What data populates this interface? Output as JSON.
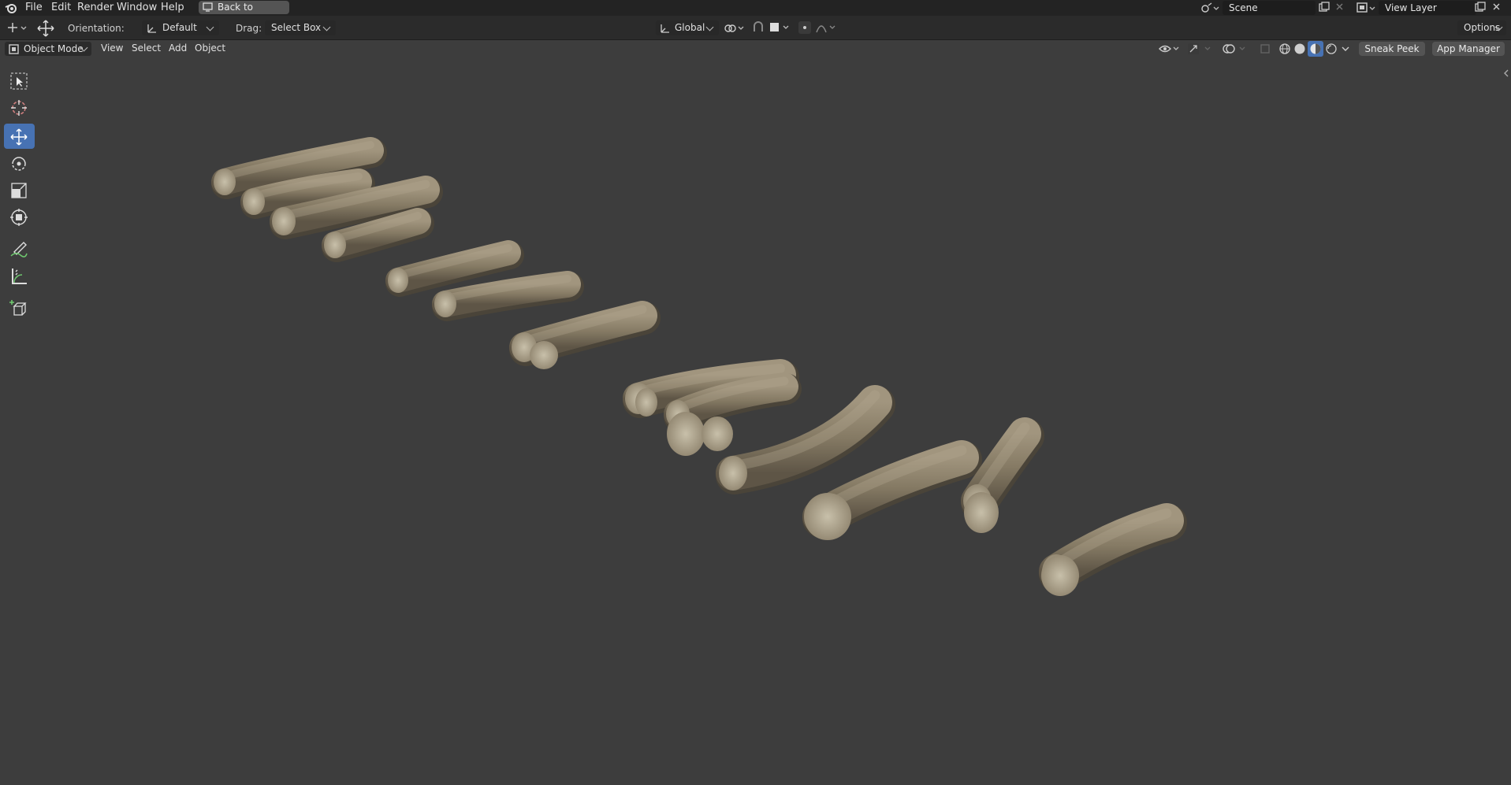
{
  "topbar": {
    "menus": [
      "File",
      "Edit",
      "Render",
      "Window",
      "Help"
    ],
    "back_button": "Back to Previous",
    "scene": "Scene",
    "view_layer": "View Layer"
  },
  "tool_header": {
    "orientation_label": "Orientation:",
    "orientation_value": "Default",
    "drag_label": "Drag:",
    "drag_value": "Select Box",
    "transform_orientation": "Global",
    "options": "Options"
  },
  "viewport_header": {
    "mode": "Object Mode",
    "menus": [
      "View",
      "Select",
      "Add",
      "Object"
    ],
    "sneak_peek": "Sneak Peek",
    "app_manager": "App Manager"
  },
  "toolbar": {
    "tools": [
      "select-box",
      "cursor",
      "move",
      "rotate",
      "scale",
      "transform",
      "annotate",
      "measure",
      "add-cube"
    ],
    "active_tool": "move"
  },
  "colors": {
    "viewport_bg": "#3d3d3d",
    "header_bg": "#232323",
    "active_tool": "#4772b3",
    "log_bark": "#8a7e6a",
    "log_cut": "#bdb49e"
  }
}
